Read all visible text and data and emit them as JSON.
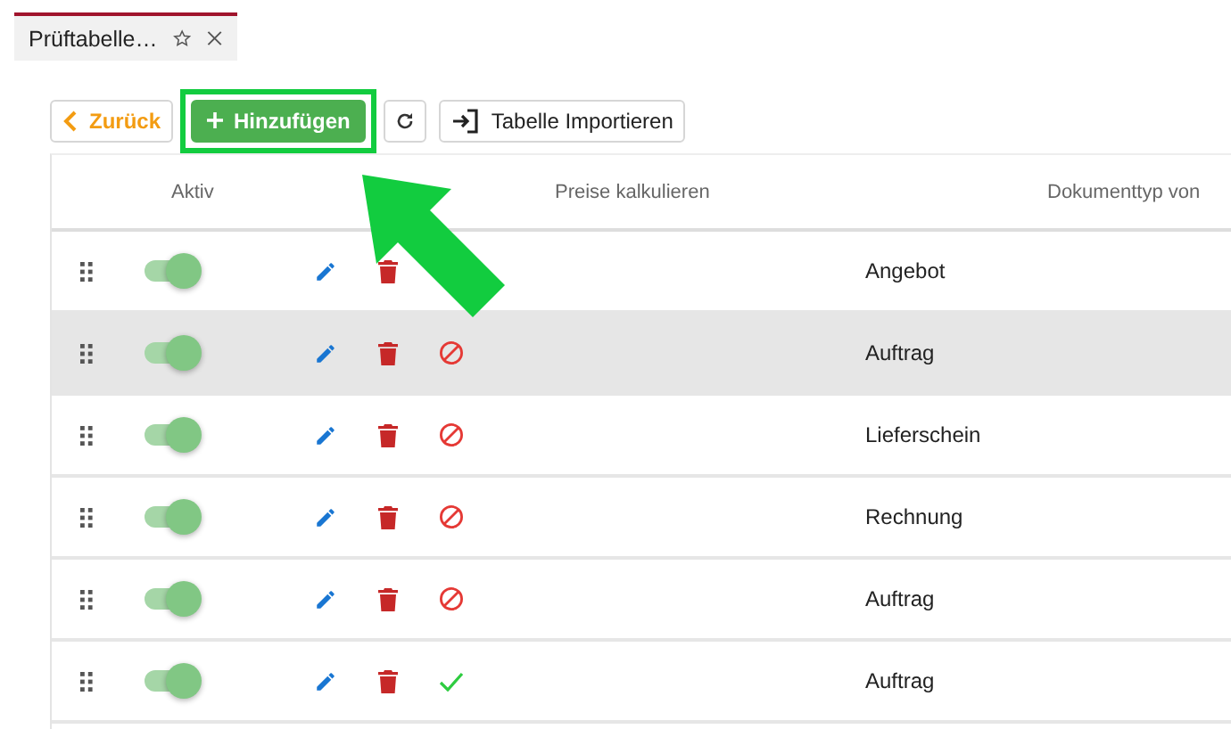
{
  "tab": {
    "title": "Prüftabelle…",
    "starred": false
  },
  "toolbar": {
    "back": "Zurück",
    "add": "Hinzufügen",
    "import": "Tabelle Importieren"
  },
  "table": {
    "columns": [
      "Aktiv",
      "Preise kalkulieren",
      "Dokumenttyp von"
    ],
    "rows": [
      {
        "active": true,
        "selected": false,
        "doc_type": "Angebot"
      },
      {
        "active": true,
        "selected": true,
        "kind": "blocked",
        "doc_type": "Auftrag"
      },
      {
        "active": true,
        "selected": false,
        "kind": "blocked",
        "doc_type": "Lieferschein"
      },
      {
        "active": true,
        "selected": false,
        "kind": "blocked",
        "doc_type": "Rechnung"
      },
      {
        "active": true,
        "selected": false,
        "kind": "blocked",
        "doc_type": "Auftrag"
      },
      {
        "active": true,
        "selected": false,
        "kind": "ok",
        "doc_type": "Auftrag"
      }
    ]
  },
  "annotation": {
    "kind": "arrow"
  }
}
